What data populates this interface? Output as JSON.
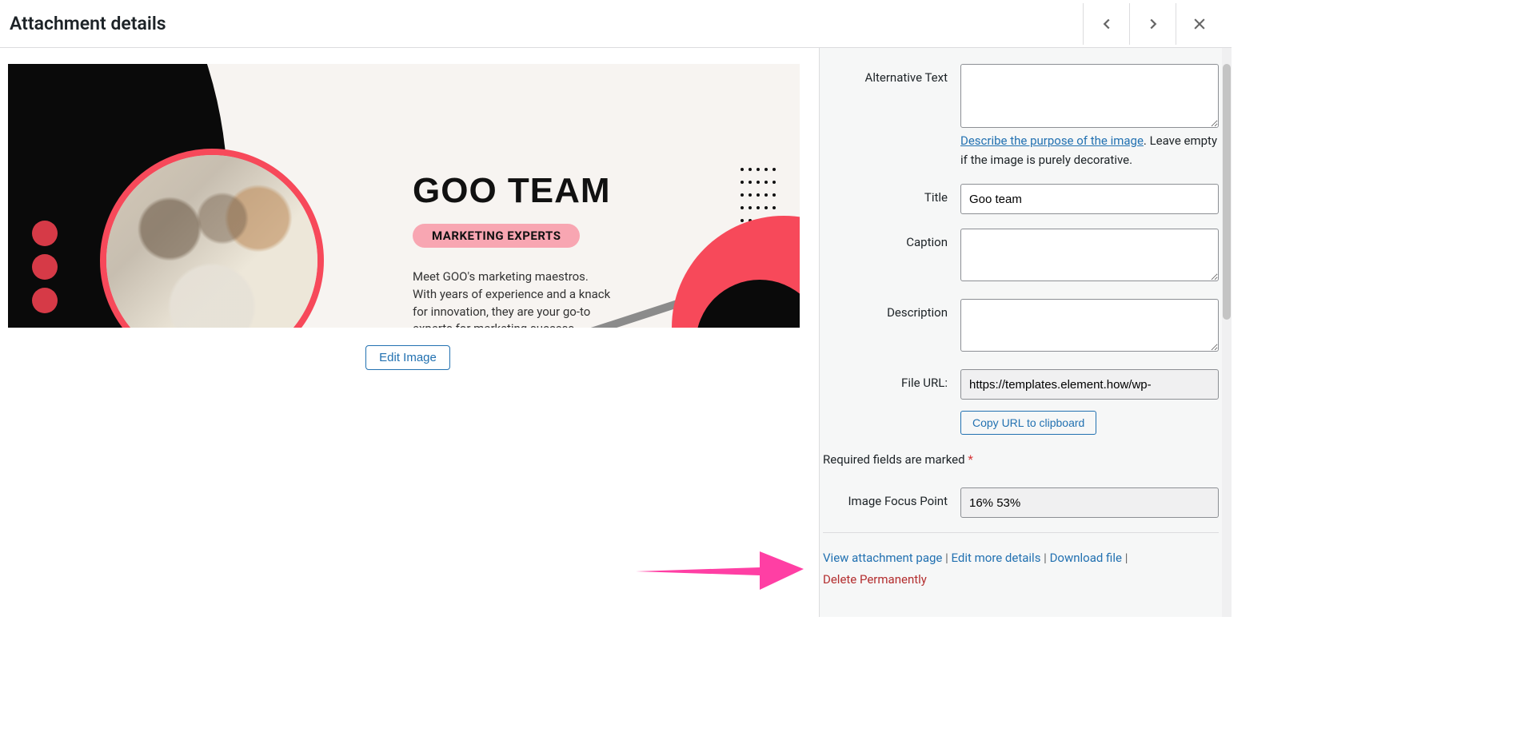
{
  "header": {
    "title": "Attachment details"
  },
  "preview": {
    "slide_title": "GOO TEAM",
    "slide_badge": "MARKETING EXPERTS",
    "slide_body": "Meet GOO's marketing maestros. With years of experience and a knack for innovation, they are your go-to experts for marketing success.",
    "edit_image": "Edit Image"
  },
  "sidebar": {
    "alt_label": "Alternative Text",
    "alt_value": "",
    "alt_help_link": "Describe the purpose of the image",
    "alt_help_text": ". Leave empty if the image is purely decorative.",
    "title_label": "Title",
    "title_value": "Goo team",
    "caption_label": "Caption",
    "caption_value": "",
    "description_label": "Description",
    "description_value": "",
    "fileurl_label": "File URL:",
    "fileurl_value": "https://templates.element.how/wp-",
    "copy_url": "Copy URL to clipboard",
    "required_note": "Required fields are marked ",
    "asterisk": "*",
    "focus_label": "Image Focus Point",
    "focus_value": "16% 53%",
    "link_view": "View attachment page",
    "link_edit": "Edit more details",
    "link_download": "Download file",
    "link_delete": "Delete Permanently",
    "pipe": " | "
  }
}
